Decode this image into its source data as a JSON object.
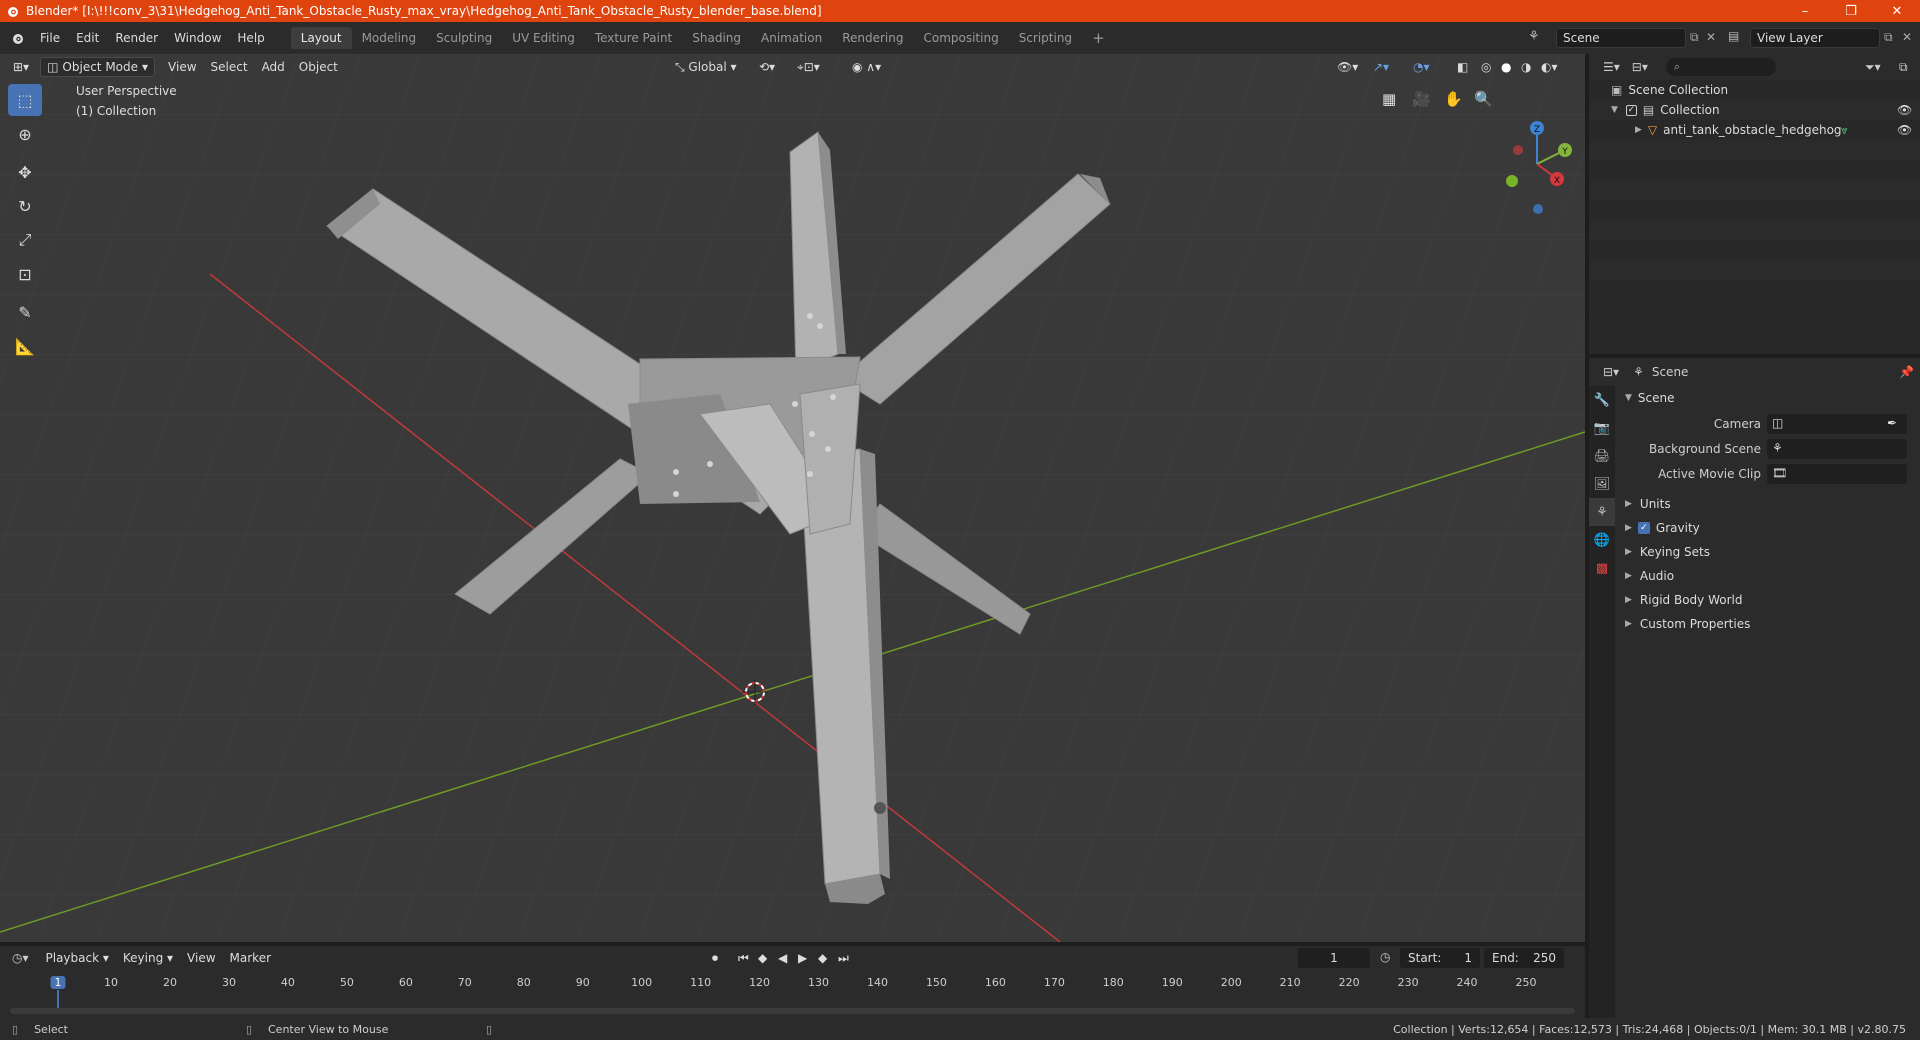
{
  "window": {
    "title": "Blender* [I:\\!!!conv_3\\31\\Hedgehog_Anti_Tank_Obstacle_Rusty_max_vray\\Hedgehog_Anti_Tank_Obstacle_Rusty_blender_base.blend]",
    "minimize": "–",
    "maximize": "❐",
    "close": "✕"
  },
  "menus": [
    "File",
    "Edit",
    "Render",
    "Window",
    "Help"
  ],
  "workspaces": [
    "Layout",
    "Modeling",
    "Sculpting",
    "UV Editing",
    "Texture Paint",
    "Shading",
    "Animation",
    "Rendering",
    "Compositing",
    "Scripting"
  ],
  "active_workspace": "Layout",
  "scene_field": "Scene",
  "view_layer_field": "View Layer",
  "viewport": {
    "mode": "Object Mode",
    "menus": [
      "View",
      "Select",
      "Add",
      "Object"
    ],
    "orientation": "Global",
    "overlay_title": "User Perspective",
    "overlay_collection": "(1) Collection",
    "gizmo_axes": {
      "x": "X",
      "y": "Y",
      "z": "Z"
    }
  },
  "outliner": {
    "root": "Scene Collection",
    "collection": "Collection",
    "object": "anti_tank_obstacle_hedgehog"
  },
  "properties": {
    "header": "Scene",
    "section": "Scene",
    "fields": [
      {
        "label": "Camera",
        "value": ""
      },
      {
        "label": "Background Scene",
        "value": ""
      },
      {
        "label": "Active Movie Clip",
        "value": ""
      }
    ],
    "subsections": [
      "Units",
      "Gravity",
      "Keying Sets",
      "Audio",
      "Rigid Body World",
      "Custom Properties"
    ],
    "gravity_checked": true
  },
  "timeline": {
    "menus": [
      "Playback",
      "Keying",
      "View",
      "Marker"
    ],
    "current_frame": "1",
    "start_label": "Start:",
    "start": "1",
    "end_label": "End:",
    "end": "250",
    "ticks": [
      "1",
      "10",
      "20",
      "30",
      "40",
      "50",
      "60",
      "70",
      "80",
      "90",
      "100",
      "110",
      "120",
      "130",
      "140",
      "150",
      "160",
      "170",
      "180",
      "190",
      "200",
      "210",
      "220",
      "230",
      "240",
      "250"
    ]
  },
  "status": {
    "select": "Select",
    "center_view": "Center View to Mouse",
    "stats": "Collection | Verts:12,654 | Faces:12,573 | Tris:24,468 | Objects:0/1 | Mem: 30.1 MB | v2.80.75"
  },
  "colors": {
    "titlebar": "#e0440e",
    "accent": "#4772b3",
    "viewport_bg": "#393939",
    "x_axis": "#c0393b",
    "y_axis": "#6f9a25"
  }
}
